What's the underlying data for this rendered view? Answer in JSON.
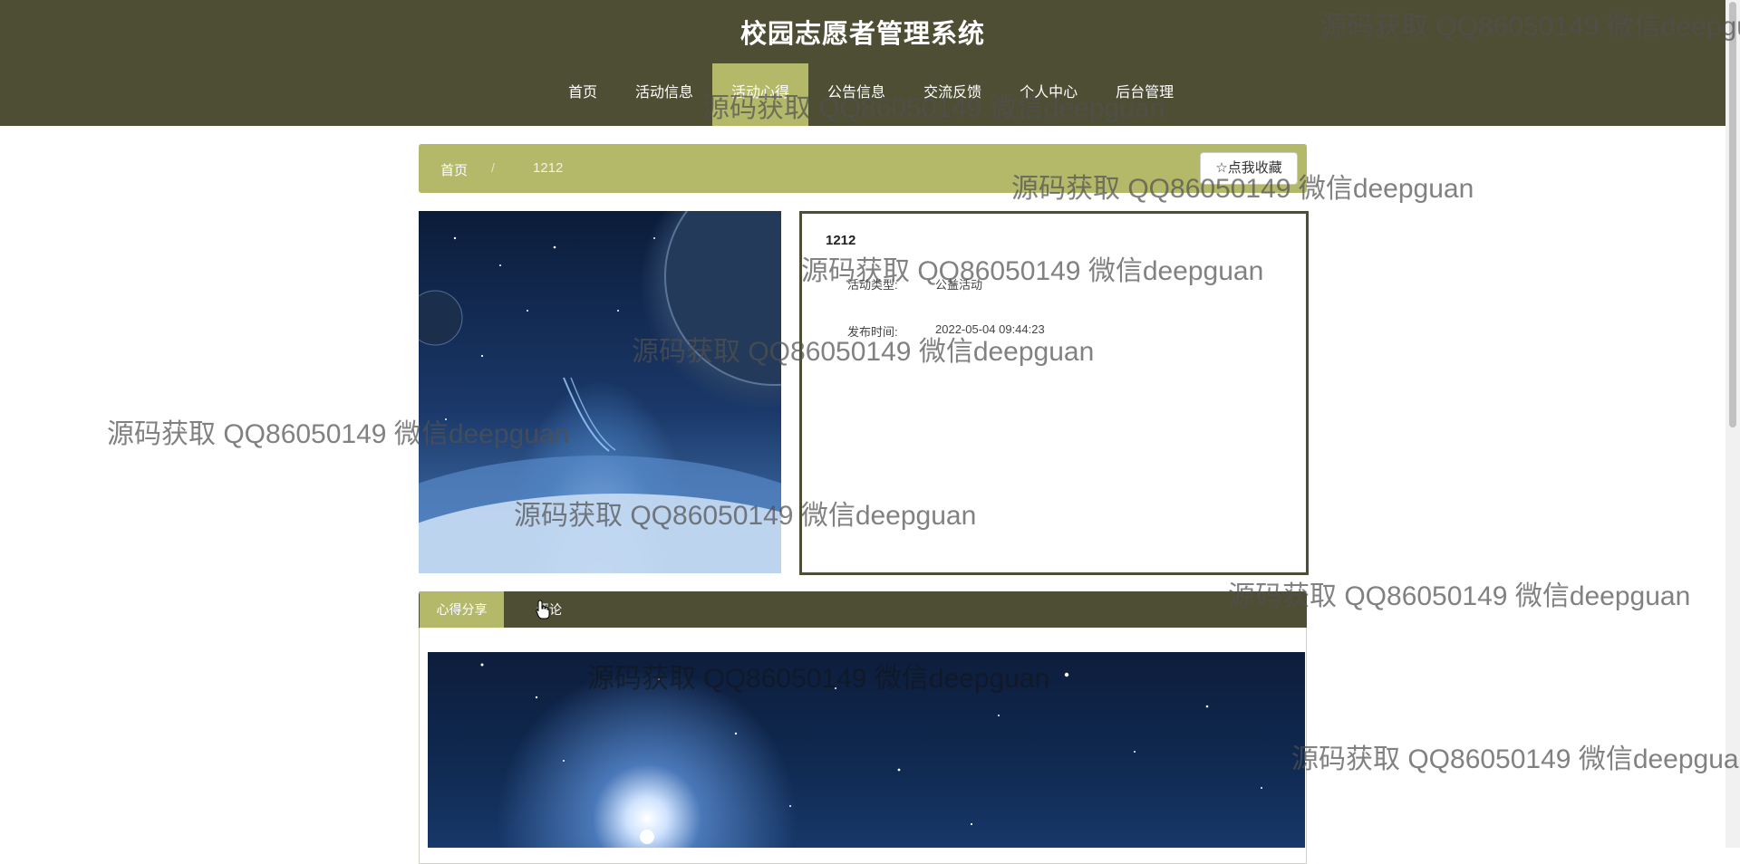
{
  "site": {
    "title": "校园志愿者管理系统"
  },
  "nav": {
    "items": [
      {
        "label": "首页"
      },
      {
        "label": "活动信息"
      },
      {
        "label": "活动心得"
      },
      {
        "label": "公告信息"
      },
      {
        "label": "交流反馈"
      },
      {
        "label": "个人中心"
      },
      {
        "label": "后台管理"
      }
    ],
    "active_index": 2
  },
  "breadcrumb": {
    "home": "首页",
    "separator": "/",
    "current": "1212"
  },
  "favorite_button": {
    "label": "☆点我收藏"
  },
  "detail": {
    "title": "1212",
    "fields": [
      {
        "label": "活动类型:",
        "value": "公益活动"
      },
      {
        "label": "发布时间:",
        "value": "2022-05-04 09:44:23"
      }
    ]
  },
  "tabs": [
    {
      "label": "心得分享",
      "active": true
    },
    {
      "label": "评论",
      "active": false
    }
  ],
  "watermark": {
    "text": "源码获取 QQ86050149 微信deepguan"
  },
  "colors": {
    "header_bg": "#4d4e34",
    "accent": "#b4b96a"
  }
}
